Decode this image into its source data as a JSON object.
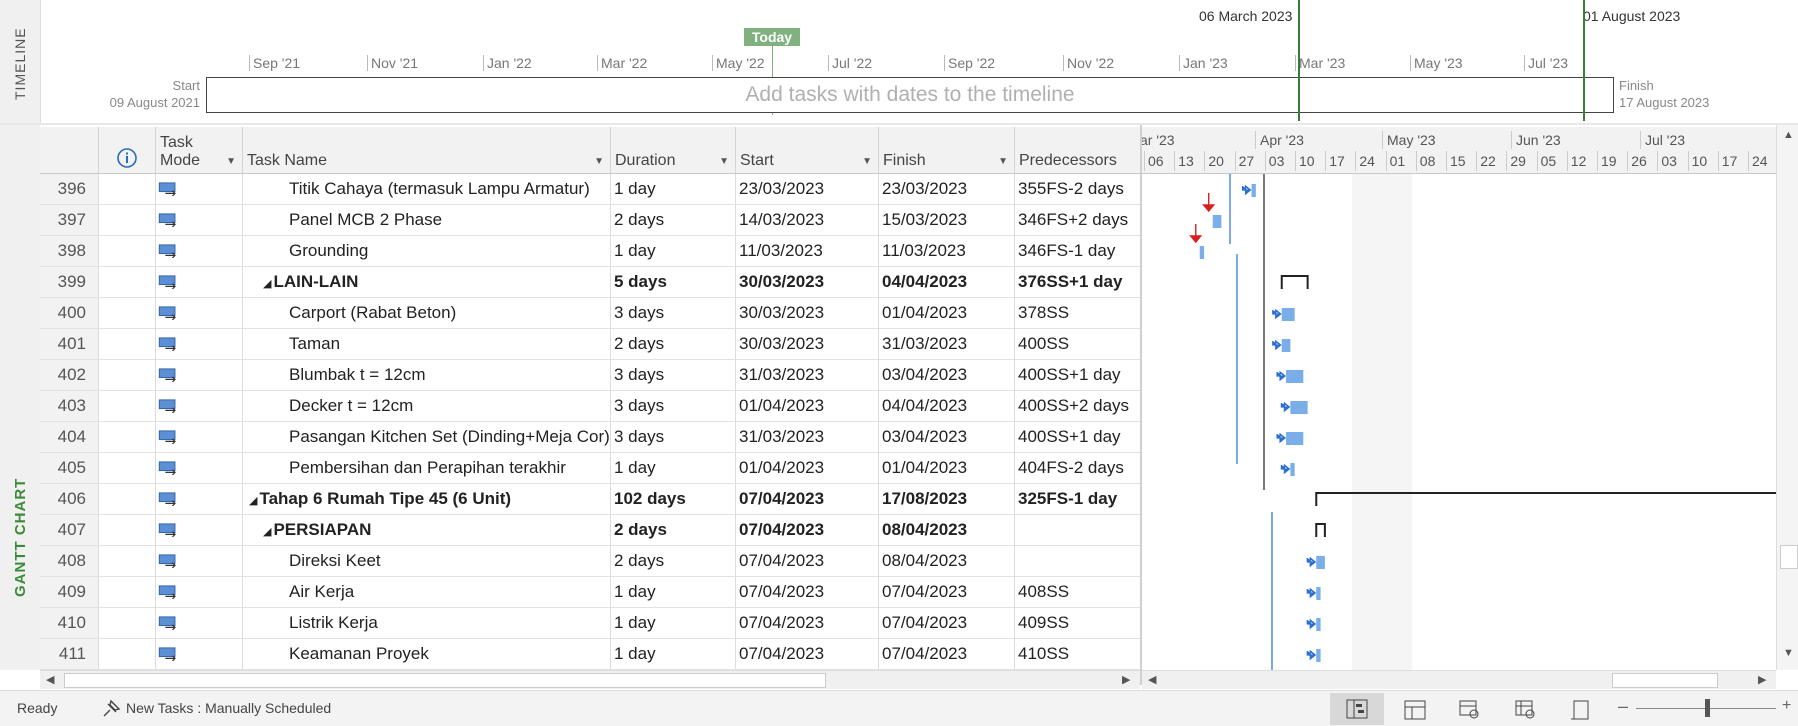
{
  "timeline": {
    "side_label": "TIMELINE",
    "today_label": "Today",
    "start_label": "Start",
    "start_date": "09 August 2021",
    "finish_label": "Finish",
    "finish_date": "17 August 2023",
    "hint": "Add tasks with dates to the timeline",
    "ticks": [
      "Sep '21",
      "Nov '21",
      "Jan '22",
      "Mar '22",
      "May '22",
      "Jul '22",
      "Sep '22",
      "Nov '22",
      "Jan '23",
      "Mar '23",
      "May '23",
      "Jul '23"
    ],
    "marker1": "06 March 2023",
    "marker2": "01 August 2023"
  },
  "gantt_side_label": "GANTT CHART",
  "columns": {
    "info_icon": "info-icon",
    "task_mode": "Task Mode",
    "task_name": "Task Name",
    "duration": "Duration",
    "start": "Start",
    "finish": "Finish",
    "predecessors": "Predecessors"
  },
  "gantt_months": [
    "ar '23",
    "Apr '23",
    "May '23",
    "Jun '23",
    "Jul '23"
  ],
  "gantt_days": [
    "06",
    "13",
    "20",
    "27",
    "03",
    "10",
    "17",
    "24",
    "01",
    "08",
    "15",
    "22",
    "29",
    "05",
    "12",
    "19",
    "26",
    "03",
    "10",
    "17",
    "24"
  ],
  "tasks": [
    {
      "id": "396",
      "name": "Titik Cahaya (termasuk Lampu Armatur)",
      "indent": 2,
      "dur": "1 day",
      "start": "23/03/2023",
      "finish": "23/03/2023",
      "pred": "355FS-2 days",
      "bold": false
    },
    {
      "id": "397",
      "name": "Panel MCB 2 Phase",
      "indent": 2,
      "dur": "2 days",
      "start": "14/03/2023",
      "finish": "15/03/2023",
      "pred": "346FS+2 days",
      "bold": false
    },
    {
      "id": "398",
      "name": "Grounding",
      "indent": 2,
      "dur": "1 day",
      "start": "11/03/2023",
      "finish": "11/03/2023",
      "pred": "346FS-1 day",
      "bold": false
    },
    {
      "id": "399",
      "name": "LAIN-LAIN",
      "indent": 1,
      "dur": "5 days",
      "start": "30/03/2023",
      "finish": "04/04/2023",
      "pred": "376SS+1 day",
      "bold": true
    },
    {
      "id": "400",
      "name": "Carport (Rabat Beton)",
      "indent": 2,
      "dur": "3 days",
      "start": "30/03/2023",
      "finish": "01/04/2023",
      "pred": "378SS",
      "bold": false
    },
    {
      "id": "401",
      "name": "Taman",
      "indent": 2,
      "dur": "2 days",
      "start": "30/03/2023",
      "finish": "31/03/2023",
      "pred": "400SS",
      "bold": false
    },
    {
      "id": "402",
      "name": "Blumbak t = 12cm",
      "indent": 2,
      "dur": "3 days",
      "start": "31/03/2023",
      "finish": "03/04/2023",
      "pred": "400SS+1 day",
      "bold": false
    },
    {
      "id": "403",
      "name": "Decker t = 12cm",
      "indent": 2,
      "dur": "3 days",
      "start": "01/04/2023",
      "finish": "04/04/2023",
      "pred": "400SS+2 days",
      "bold": false
    },
    {
      "id": "404",
      "name": "Pasangan Kitchen Set (Dinding+Meja Cor)",
      "indent": 2,
      "dur": "3 days",
      "start": "31/03/2023",
      "finish": "03/04/2023",
      "pred": "400SS+1 day",
      "bold": false
    },
    {
      "id": "405",
      "name": "Pembersihan dan Perapihan terakhir",
      "indent": 2,
      "dur": "1 day",
      "start": "01/04/2023",
      "finish": "01/04/2023",
      "pred": "404FS-2 days",
      "bold": false
    },
    {
      "id": "406",
      "name": "Tahap 6 Rumah Tipe 45 (6 Unit)",
      "indent": 0,
      "dur": "102 days",
      "start": "07/04/2023",
      "finish": "17/08/2023",
      "pred": "325FS-1 day",
      "bold": true
    },
    {
      "id": "407",
      "name": "PERSIAPAN",
      "indent": 1,
      "dur": "2 days",
      "start": "07/04/2023",
      "finish": "08/04/2023",
      "pred": "",
      "bold": true
    },
    {
      "id": "408",
      "name": "Direksi Keet",
      "indent": 2,
      "dur": "2 days",
      "start": "07/04/2023",
      "finish": "08/04/2023",
      "pred": "",
      "bold": false
    },
    {
      "id": "409",
      "name": "Air Kerja",
      "indent": 2,
      "dur": "1 day",
      "start": "07/04/2023",
      "finish": "07/04/2023",
      "pred": "408SS",
      "bold": false
    },
    {
      "id": "410",
      "name": "Listrik Kerja",
      "indent": 2,
      "dur": "1 day",
      "start": "07/04/2023",
      "finish": "07/04/2023",
      "pred": "409SS",
      "bold": false
    },
    {
      "id": "411",
      "name": "Keamanan Proyek",
      "indent": 2,
      "dur": "1 day",
      "start": "07/04/2023",
      "finish": "07/04/2023",
      "pred": "410SS",
      "bold": false
    }
  ],
  "status": {
    "ready": "Ready",
    "new_tasks": "New Tasks : Manually Scheduled"
  },
  "colors": {
    "bar": "#7aaee8",
    "critical": "#d62020",
    "accent": "#3b8a3b"
  }
}
